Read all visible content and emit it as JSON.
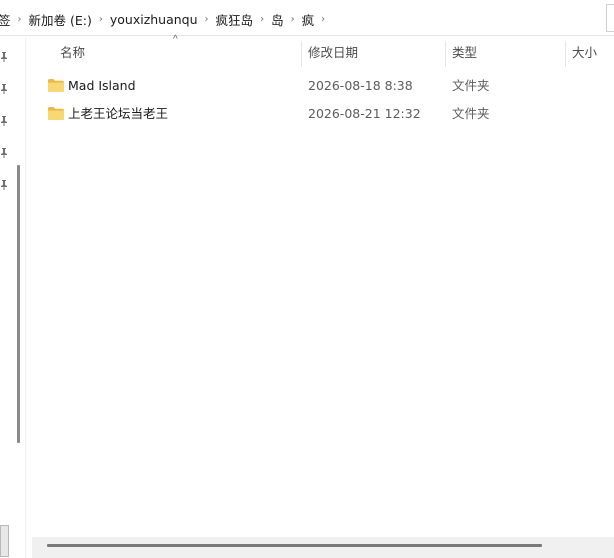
{
  "address": {
    "crumbs": [
      "签",
      "新加卷 (E:)",
      "youxizhuanqu",
      "疯狂岛",
      "岛",
      "疯"
    ],
    "separator": "›"
  },
  "columns": {
    "name": "名称",
    "modified": "修改日期",
    "type": "类型",
    "size": "大小",
    "sort_caret": "^"
  },
  "files": [
    {
      "name": "Mad Island",
      "modified": "2026-08-18 8:38",
      "type": "文件夹"
    },
    {
      "name": "上老王论坛当老王",
      "modified": "2026-08-21 12:32",
      "type": "文件夹"
    }
  ],
  "icons": {
    "folder": "folder-icon",
    "pin": "pin-icon"
  },
  "colors": {
    "folder_fill": "#f8d775",
    "folder_tab": "#e9b949",
    "header_text": "#4c4c4c"
  }
}
